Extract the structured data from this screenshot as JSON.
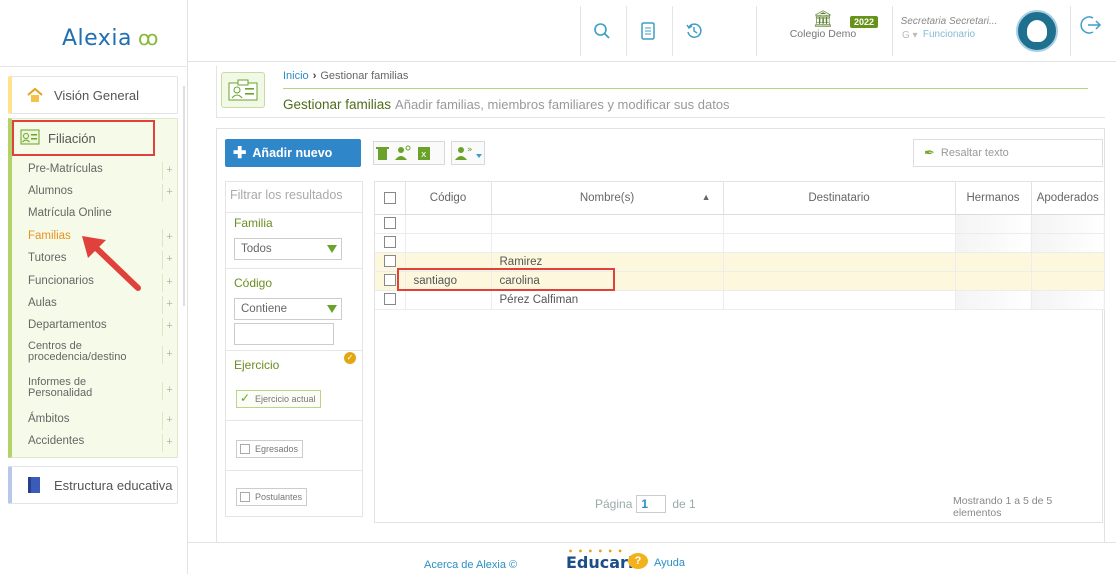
{
  "app": {
    "logo": "Alexia",
    "logo_mark": "ꝏ"
  },
  "sidebar": {
    "vision_general": "Visión General",
    "filiacion": "Filiación",
    "estructura": "Estructura educativa",
    "items": [
      {
        "label": "Pre-Matrículas",
        "plus": "+"
      },
      {
        "label": "Alumnos",
        "plus": "+"
      },
      {
        "label": "Matrícula Online",
        "plus": ""
      },
      {
        "label": "Familias",
        "plus": "+"
      },
      {
        "label": "Tutores",
        "plus": "+"
      },
      {
        "label": "Funcionarios",
        "plus": "+"
      },
      {
        "label": "Aulas",
        "plus": "+"
      },
      {
        "label": "Departamentos",
        "plus": "+"
      },
      {
        "label": "Centros de procedencia/destino",
        "plus": "+"
      },
      {
        "label": "Informes de Personalidad",
        "plus": "+"
      },
      {
        "label": "Ámbitos",
        "plus": "+"
      },
      {
        "label": "Accidentes",
        "plus": "+"
      }
    ]
  },
  "topbar": {
    "school": "Colegio Demo",
    "year": "2022",
    "user_name": "Secretaria Secretari...",
    "user_role": "Funcionario",
    "g_mark": "G ▾"
  },
  "breadcrumb": {
    "home": "Inicio",
    "separator": "›",
    "current": "Gestionar familias"
  },
  "page": {
    "title": "Gestionar familias",
    "subtitle": "Añadir familias, miembros familiares y modificar sus datos"
  },
  "toolbar": {
    "add_new": "Añadir nuevo",
    "highlight_placeholder": "Resaltar texto"
  },
  "filter": {
    "search_placeholder": "Filtrar los resultados",
    "familia_label": "Familia",
    "familia_value": "Todos",
    "codigo_label": "Código",
    "codigo_value": "Contiene",
    "ejercicio_label": "Ejercicio",
    "ejercicio_actual": "Ejercicio actual",
    "egresados": "Egresados",
    "postulantes": "Postulantes"
  },
  "table": {
    "headers": [
      "Código",
      "Nombre(s)",
      "Destinatario",
      "Hermanos",
      "Apoderados"
    ],
    "sort_indicator": "▲",
    "rows": [
      {
        "codigo": "",
        "nombre": ""
      },
      {
        "codigo": "",
        "nombre": ""
      },
      {
        "codigo": "",
        "nombre": "Ramirez"
      },
      {
        "codigo": "santiago",
        "nombre": "carolina"
      },
      {
        "codigo": "",
        "nombre": "Pérez Calfiman"
      }
    ]
  },
  "pager": {
    "label": "Página",
    "page": "1",
    "of": "de 1"
  },
  "count": "Mostrando 1 a 5 de 5 elementos",
  "footer": {
    "about": "Acerca de Alexia ©",
    "brand": "Educaria",
    "help": "Ayuda"
  },
  "colors": {
    "accent": "#2f86c8",
    "green": "#6aa329",
    "highlight": "#fdf8dd",
    "annotation": "#e0413b"
  }
}
